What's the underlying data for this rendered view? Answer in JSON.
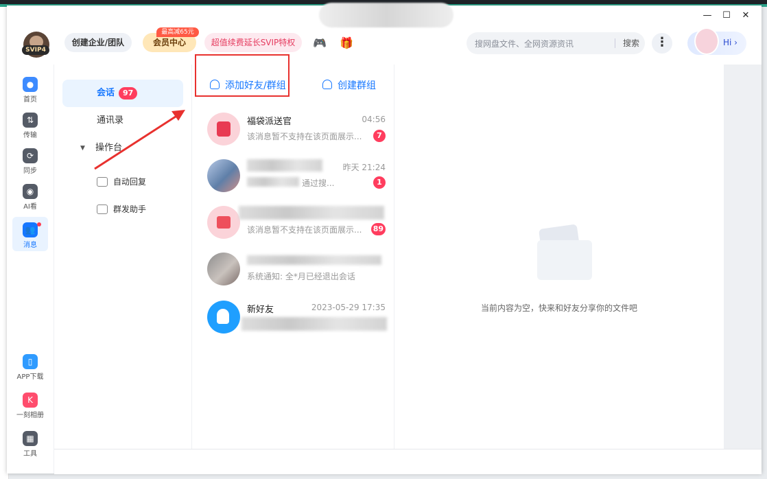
{
  "window": {
    "minimize": "—",
    "maximize": "☐",
    "close": "✕"
  },
  "header": {
    "avatar_badge": "SVIP4",
    "create_team": "创建企业/团队",
    "vip_center": "会员中心",
    "vip_tag": "最高减65元",
    "svip_promo": "超值续费延长SVIP特权",
    "game_icon": "🎮",
    "gift_icon": "🎁",
    "search_placeholder": "搜网盘文件、全网资源资讯",
    "search_button": "搜索",
    "more": "⋮",
    "hi": "Hi ›"
  },
  "sidebar": {
    "items": [
      {
        "label": "首页",
        "icon": "home-icon",
        "color": "#3d8bff"
      },
      {
        "label": "传输",
        "icon": "transfer-icon",
        "color": "#555b66"
      },
      {
        "label": "同步",
        "icon": "sync-icon",
        "color": "#555b66"
      },
      {
        "label": "AI看",
        "icon": "ai-icon",
        "color": "#555b66"
      },
      {
        "label": "消息",
        "icon": "message-icon",
        "color": "#1677ff"
      }
    ],
    "bottom_items": [
      {
        "label": "APP下载",
        "icon": "phone-icon",
        "color": "#2f9bff"
      },
      {
        "label": "一刻相册",
        "icon": "album-icon",
        "color": "#ff4d6d"
      },
      {
        "label": "工具",
        "icon": "grid-icon",
        "color": "#555b66"
      }
    ]
  },
  "chat_menu": {
    "conversations": "会话",
    "conversations_count": "97",
    "contacts": "通讯录",
    "console": "操作台",
    "auto_reply": "自动回复",
    "group_send": "群发助手"
  },
  "actions": {
    "add_friend": "添加好友/群组",
    "create_group": "创建群组"
  },
  "conversations": [
    {
      "name": "福袋派送官",
      "time": "04:56",
      "preview": "该消息暂不支持在该页面展示...",
      "count": "7",
      "avatar_color": "#fbd3d9"
    },
    {
      "name": "",
      "time": "昨天 21:24",
      "preview": "通过搜...",
      "count": "1",
      "avatar_color": "#9db7d6"
    },
    {
      "name": "",
      "time": "",
      "preview": "该消息暂不支持在该页面展示...",
      "count": "89",
      "avatar_color": "#fbd3d9"
    },
    {
      "name": "",
      "time": "",
      "preview": "系统通知: 全*月已经退出会话",
      "count": "",
      "avatar_color": "#8d8d8d"
    },
    {
      "name": "新好友",
      "time": "2023-05-29 17:35",
      "preview": "",
      "count": "",
      "avatar_color": "#1f9fff"
    }
  ],
  "empty": {
    "text": "当前内容为空，快来和好友分享你的文件吧"
  },
  "colors": {
    "accent": "#1677ff",
    "badge": "#ff3d5e",
    "highlight": "#e8312e"
  }
}
